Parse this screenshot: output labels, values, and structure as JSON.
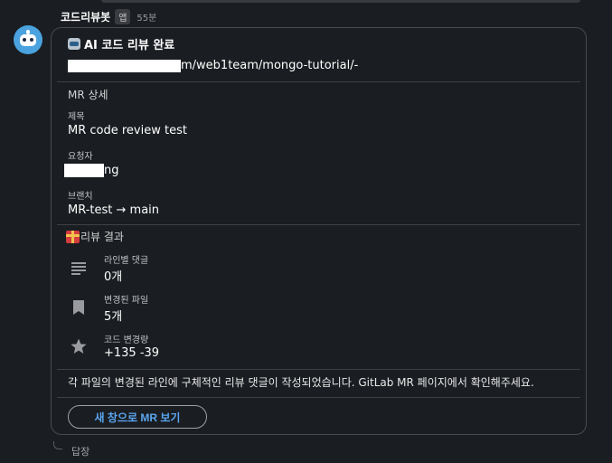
{
  "message": {
    "sender": "코드리뷰봇",
    "badge": "앱",
    "time": "55분"
  },
  "card": {
    "title": "AI 코드 리뷰 완료",
    "url_suffix": "m/web1team/mongo-tutorial/-",
    "details_heading": "MR 상세",
    "fields": [
      {
        "label": "제목",
        "value": "MR code review test"
      },
      {
        "label": "요청자",
        "value": "ng"
      },
      {
        "label": "브랜치",
        "value": "MR-test → main"
      }
    ],
    "results_heading": "리뷰 결과",
    "stats": [
      {
        "icon": "lines-icon",
        "label": "라인별 댓글",
        "value": "0개"
      },
      {
        "icon": "bookmark-icon",
        "label": "변경된 파일",
        "value": "5개"
      },
      {
        "icon": "star-icon",
        "label": "코드 변경량",
        "value": "+135 -39"
      }
    ],
    "note": "각 파일의 변경된 라인에 구체적인 리뷰 댓글이 작성되었습니다. GitLab MR 페이지에서 확인해주세요.",
    "button_label": "새 창으로 MR 보기"
  },
  "reply_label": "답장"
}
